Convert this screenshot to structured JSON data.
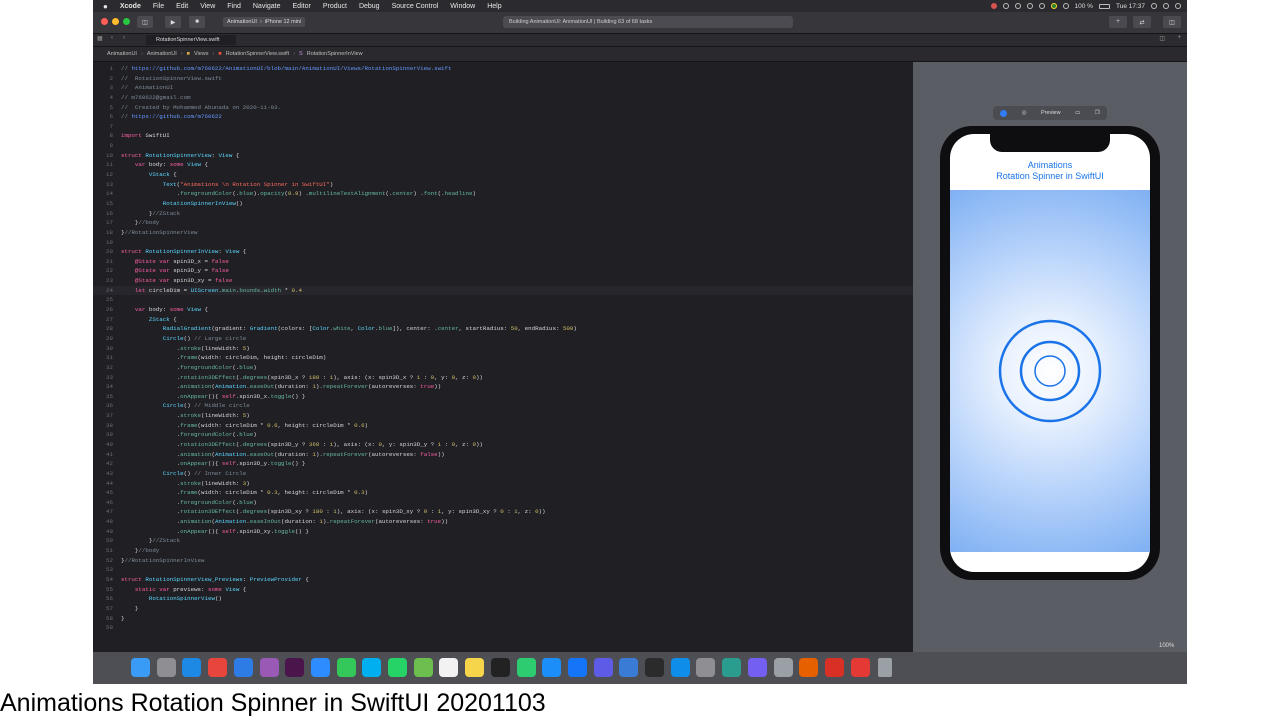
{
  "menubar": {
    "app": "Xcode",
    "items": [
      "File",
      "Edit",
      "View",
      "Find",
      "Navigate",
      "Editor",
      "Product",
      "Debug",
      "Source Control",
      "Window",
      "Help"
    ],
    "right": {
      "battery": "100 %",
      "time": "Tue 17:37"
    }
  },
  "toolbar": {
    "scheme": "AnimationUI",
    "device": "iPhone 12 mini",
    "status": "Building AnimationUI: AnimationUI | Building 63 of 68 tasks"
  },
  "tab": {
    "label": "RotationSpinnerView.swift"
  },
  "jumpbar": [
    "AnimationUI",
    "AnimationUI",
    "Views",
    "RotationSpinnerView.swift",
    "RotationSpinnerInView"
  ],
  "code_lines": [
    {
      "n": "1",
      "html": "<span class=\"cmt\">// </span><span class=\"url\">https://github.com/m760622/AnimationUI/blob/main/AnimationUI/Views/RotationSpinnerView.swift</span>"
    },
    {
      "n": "2",
      "html": "<span class=\"cmt\">//  RotationSpinnerView.swift</span>"
    },
    {
      "n": "3",
      "html": "<span class=\"cmt\">//  AnimationUI</span>"
    },
    {
      "n": "4",
      "html": "<span class=\"cmt\">// m760622@gmail.com</span>"
    },
    {
      "n": "5",
      "html": "<span class=\"cmt\">//  Created by Mohammed Abunada on 2020-11-03.</span>"
    },
    {
      "n": "6",
      "html": "<span class=\"cmt\">// </span><span class=\"url\">https://github.com/m760622</span>"
    },
    {
      "n": "7",
      "html": ""
    },
    {
      "n": "8",
      "html": "<span class=\"kw\">import</span> SwiftUI"
    },
    {
      "n": "9",
      "html": ""
    },
    {
      "n": "10",
      "html": "<span class=\"kw\">struct</span> <span class=\"typ\">RotationSpinnerView</span>: <span class=\"typ\">View</span> {"
    },
    {
      "n": "11",
      "html": "    <span class=\"kw\">var</span> body: <span class=\"kw\">some</span> <span class=\"typ\">View</span> {"
    },
    {
      "n": "12",
      "html": "        <span class=\"typ\">VStack</span> {"
    },
    {
      "n": "13",
      "html": "            <span class=\"typ\">Text</span>(<span class=\"str\">\"Animations \\n Rotation Spinner in SwiftUI\"</span>)"
    },
    {
      "n": "14",
      "html": "                .<span class=\"fn\">foregroundColor</span>(.<span class=\"fn\">blue</span>).<span class=\"fn\">opacity</span>(<span class=\"num\">0.9</span>) .<span class=\"fn\">multilineTextAlignment</span>(.<span class=\"fn\">center</span>) .<span class=\"fn\">font</span>(.<span class=\"fn\">headline</span>)"
    },
    {
      "n": "15",
      "html": "            <span class=\"typ\">RotationSpinnerInView</span>()"
    },
    {
      "n": "16",
      "html": "        }<span class=\"cmt\">//ZStack</span>"
    },
    {
      "n": "17",
      "html": "    }<span class=\"cmt\">//body</span>"
    },
    {
      "n": "18",
      "html": "}<span class=\"cmt\">//RotationSpinnerView</span>"
    },
    {
      "n": "19",
      "html": ""
    },
    {
      "n": "20",
      "html": "<span class=\"kw\">struct</span> <span class=\"typ\">RotationSpinnerInView</span>: <span class=\"typ\">View</span> {"
    },
    {
      "n": "21",
      "html": "    <span class=\"kw\">@State</span> <span class=\"kw\">var</span> spin3D_x = <span class=\"kw\">false</span>"
    },
    {
      "n": "22",
      "html": "    <span class=\"kw\">@State</span> <span class=\"kw\">var</span> spin3D_y = <span class=\"kw\">false</span>"
    },
    {
      "n": "23",
      "html": "    <span class=\"kw\">@State</span> <span class=\"kw\">var</span> spin3D_xy = <span class=\"kw\">false</span>"
    },
    {
      "n": "24",
      "html": "    <span class=\"kw\">let</span> circleDim = <span class=\"typ\">UIScreen</span>.<span class=\"fn\">main</span>.<span class=\"fn\">bounds</span>.<span class=\"fn\">width</span> * <span class=\"num\">0.4</span>",
      "cur": true
    },
    {
      "n": "25",
      "html": ""
    },
    {
      "n": "26",
      "html": "    <span class=\"kw\">var</span> body: <span class=\"kw\">some</span> <span class=\"typ\">View</span> {"
    },
    {
      "n": "27",
      "html": "        <span class=\"typ\">ZStack</span> {"
    },
    {
      "n": "28",
      "html": "            <span class=\"typ\">RadialGradient</span>(gradient: <span class=\"typ\">Gradient</span>(colors: [<span class=\"typ\">Color</span>.<span class=\"fn\">white</span>, <span class=\"typ\">Color</span>.<span class=\"fn\">blue</span>]), center: .<span class=\"fn\">center</span>, startRadius: <span class=\"num\">50</span>, endRadius: <span class=\"num\">500</span>)"
    },
    {
      "n": "29",
      "html": "            <span class=\"typ\">Circle</span>() <span class=\"cmt\">// Large circle</span>"
    },
    {
      "n": "30",
      "html": "                .<span class=\"fn\">stroke</span>(lineWidth: <span class=\"num\">5</span>)"
    },
    {
      "n": "31",
      "html": "                .<span class=\"fn\">frame</span>(width: circleDim, height: circleDim)"
    },
    {
      "n": "32",
      "html": "                .<span class=\"fn\">foregroundColor</span>(.<span class=\"fn\">blue</span>)"
    },
    {
      "n": "33",
      "html": "                .<span class=\"fn\">rotation3DEffect</span>(.<span class=\"fn\">degrees</span>(spin3D_x ? <span class=\"num\">180</span> : <span class=\"num\">1</span>), axis: (x: spin3D_x ? <span class=\"num\">1</span> : <span class=\"num\">0</span>, y: <span class=\"num\">0</span>, z: <span class=\"num\">0</span>))"
    },
    {
      "n": "34",
      "html": "                .<span class=\"fn\">animation</span>(<span class=\"typ\">Animation</span>.<span class=\"fn\">easeOut</span>(duration: <span class=\"num\">1</span>).<span class=\"fn\">repeatForever</span>(autoreverses: <span class=\"kw\">true</span>))"
    },
    {
      "n": "35",
      "html": "                .<span class=\"fn\">onAppear</span>(){ <span class=\"kw\">self</span>.spin3D_x.<span class=\"fn\">toggle</span>() }"
    },
    {
      "n": "36",
      "html": "            <span class=\"typ\">Circle</span>() <span class=\"cmt\">// Middle circle</span>"
    },
    {
      "n": "37",
      "html": "                .<span class=\"fn\">stroke</span>(lineWidth: <span class=\"num\">5</span>)"
    },
    {
      "n": "38",
      "html": "                .<span class=\"fn\">frame</span>(width: circleDim * <span class=\"num\">0.6</span>, height: circleDim * <span class=\"num\">0.6</span>)"
    },
    {
      "n": "39",
      "html": "                .<span class=\"fn\">foregroundColor</span>(.<span class=\"fn\">blue</span>)"
    },
    {
      "n": "40",
      "html": "                .<span class=\"fn\">rotation3DEffect</span>(.<span class=\"fn\">degrees</span>(spin3D_y ? <span class=\"num\">360</span> : <span class=\"num\">1</span>), axis: (x: <span class=\"num\">0</span>, y: spin3D_y ? <span class=\"num\">1</span> : <span class=\"num\">0</span>, z: <span class=\"num\">0</span>))"
    },
    {
      "n": "41",
      "html": "                .<span class=\"fn\">animation</span>(<span class=\"typ\">Animation</span>.<span class=\"fn\">easeOut</span>(duration: <span class=\"num\">1</span>).<span class=\"fn\">repeatForever</span>(autoreverses: <span class=\"kw\">false</span>))"
    },
    {
      "n": "42",
      "html": "                .<span class=\"fn\">onAppear</span>(){ <span class=\"kw\">self</span>.spin3D_y.<span class=\"fn\">toggle</span>() }"
    },
    {
      "n": "43",
      "html": "            <span class=\"typ\">Circle</span>() <span class=\"cmt\">// Inner Circle</span>"
    },
    {
      "n": "44",
      "html": "                .<span class=\"fn\">stroke</span>(lineWidth: <span class=\"num\">3</span>)"
    },
    {
      "n": "45",
      "html": "                .<span class=\"fn\">frame</span>(width: circleDim * <span class=\"num\">0.3</span>, height: circleDim * <span class=\"num\">0.3</span>)"
    },
    {
      "n": "46",
      "html": "                .<span class=\"fn\">foregroundColor</span>(.<span class=\"fn\">blue</span>)"
    },
    {
      "n": "47",
      "html": "                .<span class=\"fn\">rotation3DEffect</span>(.<span class=\"fn\">degrees</span>(spin3D_xy ? <span class=\"num\">180</span> : <span class=\"num\">1</span>), axis: (x: spin3D_xy ? <span class=\"num\">0</span> : <span class=\"num\">1</span>, y: spin3D_xy ? <span class=\"num\">0</span> : <span class=\"num\">1</span>, z: <span class=\"num\">0</span>))"
    },
    {
      "n": "48",
      "html": "                .<span class=\"fn\">animation</span>(<span class=\"typ\">Animation</span>.<span class=\"fn\">easeInOut</span>(duration: <span class=\"num\">1</span>).<span class=\"fn\">repeatForever</span>(autoreverses: <span class=\"kw\">true</span>))"
    },
    {
      "n": "49",
      "html": "                .<span class=\"fn\">onAppear</span>(){ <span class=\"kw\">self</span>.spin3D_xy.<span class=\"fn\">toggle</span>() }"
    },
    {
      "n": "50",
      "html": "        }<span class=\"cmt\">//ZStack</span>"
    },
    {
      "n": "51",
      "html": "    }<span class=\"cmt\">//body</span>"
    },
    {
      "n": "52",
      "html": "}<span class=\"cmt\">//RotationSpinnerInView</span>"
    },
    {
      "n": "53",
      "html": ""
    },
    {
      "n": "54",
      "html": "<span class=\"kw\">struct</span> <span class=\"typ\">RotationSpinnerView_Previews</span>: <span class=\"typ\">PreviewProvider</span> {"
    },
    {
      "n": "55",
      "html": "    <span class=\"kw\">static</span> <span class=\"kw\">var</span> previews: <span class=\"kw\">some</span> <span class=\"typ\">View</span> {"
    },
    {
      "n": "56",
      "html": "        <span class=\"typ\">RotationSpinnerView</span>()"
    },
    {
      "n": "57",
      "html": "    }"
    },
    {
      "n": "58",
      "html": "}"
    },
    {
      "n": "59",
      "html": ""
    }
  ],
  "preview": {
    "bar_label": "Preview",
    "title_line1": "Animations",
    "title_line2": "Rotation Spinner in SwiftUI",
    "zoom": "100%",
    "accent": "#1a73e8"
  },
  "dock": {
    "icons": [
      "finder-icon",
      "launchpad-icon",
      "safari-icon",
      "chrome-icon",
      "mail-icon",
      "podcasts-icon",
      "slack-icon",
      "zoom-icon",
      "messages-icon",
      "skype-icon",
      "whatsapp-icon",
      "maps-icon",
      "calendar-icon",
      "notes-icon",
      "tv-icon",
      "numbers-icon",
      "app-store-icon",
      "xcode-icon",
      "xcode-instruments-icon",
      "simulator-icon",
      "obs-icon",
      "teamviewer-icon",
      "preferences-icon",
      "vpn-icon",
      "viber-icon",
      "photo-icon",
      "firefox-icon",
      "acrobat-icon",
      "screen-recorder-icon",
      "trash-icon"
    ],
    "colors": [
      "#3a9bf7",
      "#8e8e93",
      "#1e88e5",
      "#e8453c",
      "#2d7be4",
      "#9b59b6",
      "#4a154b",
      "#2d8cff",
      "#34c759",
      "#00aff0",
      "#25d366",
      "#6cbf4f",
      "#f2f2f2",
      "#f7d54a",
      "#222222",
      "#2ecc71",
      "#1c8ef9",
      "#1575f9",
      "#5e5ce6",
      "#3a7bd5",
      "#2b2b2b",
      "#0e8ee9",
      "#8e8e93",
      "#2a9d8f",
      "#7360f2",
      "#9aa0a6",
      "#e66000",
      "#d93025",
      "#e53935",
      "#9aa0a6"
    ]
  },
  "caption": "Animations Rotation Spinner in SwiftUI 20201103"
}
